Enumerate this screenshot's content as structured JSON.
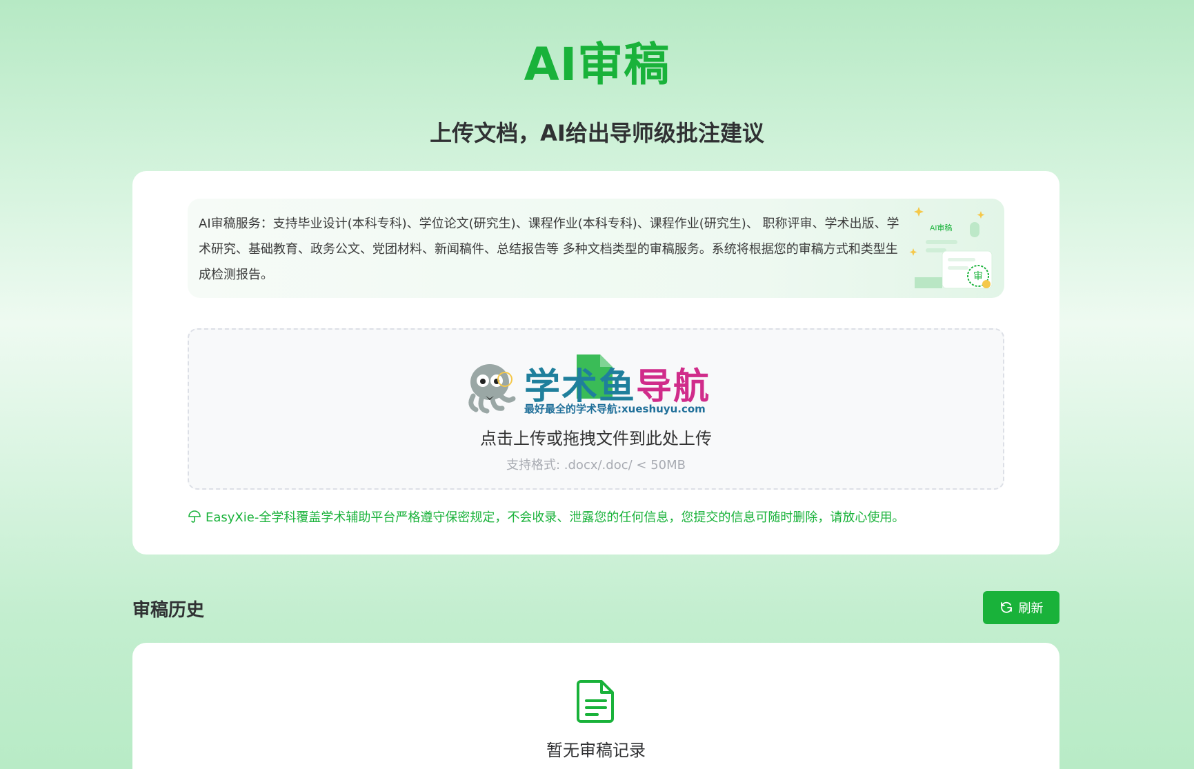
{
  "header": {
    "title": "AI审稿",
    "subtitle": "上传文档，AI给出导师级批注建议"
  },
  "service": {
    "description": "AI审稿服务：支持毕业设计(本科专科)、学位论文(研究生)、课程作业(本科专科)、课程作业(研究生)、 职称评审、学术出版、学术研究、基础教育、政务公文、党团材料、新闻稿件、总结报告等 多种文档类型的审稿服务。系统将根据您的审稿方式和类型生成检测报告。",
    "art_label": "AI审稿",
    "art_seal": "审"
  },
  "upload": {
    "prompt": "点击上传或拖拽文件到此处上传",
    "formats": "支持格式: .docx/.doc/ < 50MB"
  },
  "watermark": {
    "title_part1": "学术",
    "title_part2": "鱼",
    "title_part3": "导航",
    "subtitle": "最好最全的学术导航:xueshuyu.com"
  },
  "privacy": {
    "note": "EasyXie-全学科覆盖学术辅助平台严格遵守保密规定，不会收录、泄露您的任何信息，您提交的信息可随时删除，请放心使用。"
  },
  "history": {
    "title": "审稿历史",
    "refresh_label": "刷新",
    "empty_text": "暂无审稿记录"
  },
  "colors": {
    "brand_green": "#19b23a"
  }
}
